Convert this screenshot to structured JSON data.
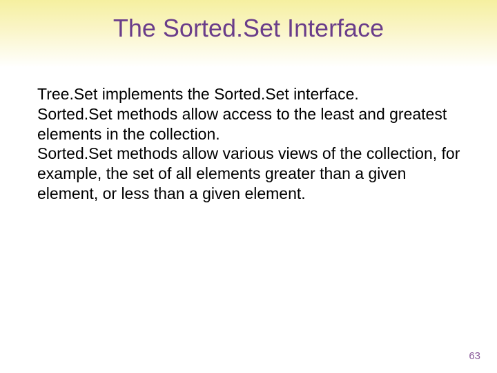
{
  "title": "The Sorted.Set Interface",
  "paragraphs": [
    "Tree.Set implements the Sorted.Set interface.",
    "Sorted.Set methods allow access to the least and greatest elements in the collection.",
    "Sorted.Set methods allow various views of the collection, for example, the set of all elements greater than a given element, or less than a given element."
  ],
  "page_number": "63"
}
